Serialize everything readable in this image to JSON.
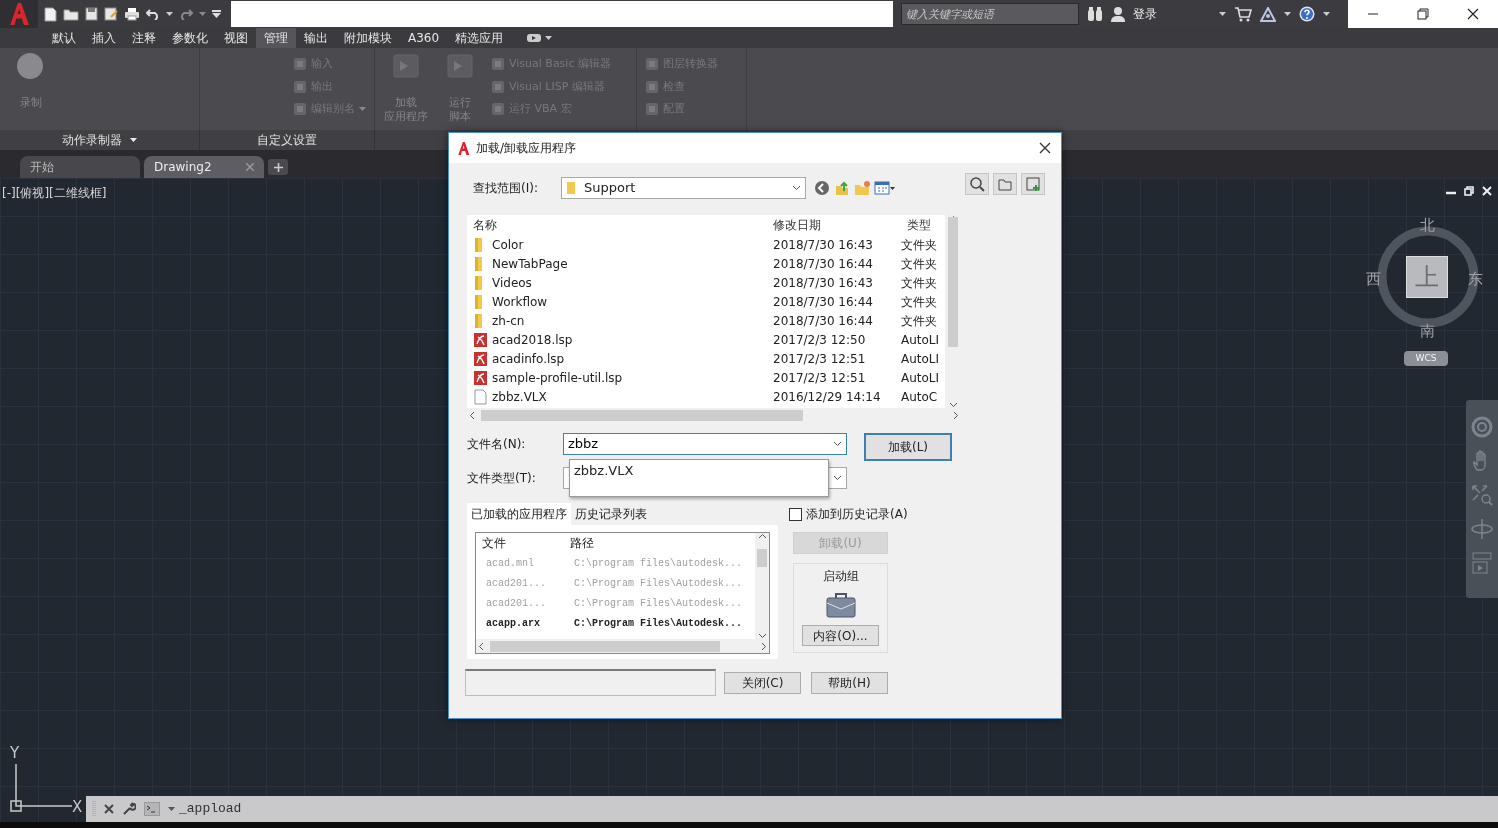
{
  "title_bar": {
    "search": {
      "placeholder": "键入关键字或短语"
    },
    "sign_in": "登录"
  },
  "ribbon_tabs": [
    {
      "label": "默认",
      "selected": false
    },
    {
      "label": "插入",
      "selected": false
    },
    {
      "label": "注释",
      "selected": false
    },
    {
      "label": "参数化",
      "selected": false
    },
    {
      "label": "视图",
      "selected": false
    },
    {
      "label": "管理",
      "selected": true
    },
    {
      "label": "输出",
      "selected": false
    },
    {
      "label": "附加模块",
      "selected": false
    },
    {
      "label": "A360",
      "selected": false
    },
    {
      "label": "精选应用",
      "selected": false
    }
  ],
  "ribbon_panels": [
    {
      "title": "动作录制器",
      "dropdown": true,
      "large": [
        {
          "lines": [
            "录制"
          ]
        }
      ]
    },
    {
      "title": "自定义设置",
      "dropdown": false,
      "small": [
        {
          "label": "输入",
          "dropdown": false
        },
        {
          "label": "输出",
          "dropdown": false
        },
        {
          "label": "编辑别名",
          "dropdown": true
        }
      ]
    },
    {
      "large": [
        {
          "lines": [
            "加载",
            "应用程序"
          ]
        },
        {
          "lines": [
            "运行",
            "脚本"
          ]
        }
      ],
      "small": [
        {
          "label": "Visual Basic 编辑器",
          "dropdown": false
        },
        {
          "label": "Visual LISP 编辑器",
          "dropdown": false
        },
        {
          "label": "运行 VBA 宏",
          "dropdown": false
        }
      ]
    },
    {
      "small": [
        {
          "label": "图层转换器",
          "dropdown": false
        },
        {
          "label": "检查",
          "dropdown": false
        },
        {
          "label": "配置",
          "dropdown": false
        }
      ]
    }
  ],
  "file_tabs": [
    {
      "label": "开始",
      "selected": false
    },
    {
      "label": "Drawing2",
      "selected": true
    }
  ],
  "viewport": {
    "label": "[-][俯视][二维线框]"
  },
  "viewcube": {
    "north": "北",
    "west": "西",
    "top": "上",
    "east": "东",
    "south": "南",
    "wcs": "WCS"
  },
  "ucs": {
    "y": "Y",
    "x": "X"
  },
  "command_line": {
    "value": "_appload"
  },
  "dialog": {
    "title": "加载/卸载应用程序",
    "look_in_label": "查找范围(I):",
    "look_in": "Support",
    "columns": [
      "名称",
      "修改日期",
      "类型"
    ],
    "files": [
      {
        "kind": "folder",
        "name": "Color",
        "date": "2018/7/30 16:43",
        "type": "文件夹"
      },
      {
        "kind": "folder",
        "name": "NewTabPage",
        "date": "2018/7/30 16:44",
        "type": "文件夹"
      },
      {
        "kind": "folder",
        "name": "Videos",
        "date": "2018/7/30 16:43",
        "type": "文件夹"
      },
      {
        "kind": "folder",
        "name": "Workflow",
        "date": "2018/7/30 16:44",
        "type": "文件夹"
      },
      {
        "kind": "folder",
        "name": "zh-cn",
        "date": "2018/7/30 16:44",
        "type": "文件夹"
      },
      {
        "kind": "lisp",
        "name": "acad2018.lsp",
        "date": "2017/2/3 12:50",
        "type": "AutoLI"
      },
      {
        "kind": "lisp",
        "name": "acadinfo.lsp",
        "date": "2017/2/3 12:51",
        "type": "AutoLI"
      },
      {
        "kind": "lisp",
        "name": "sample-profile-util.lsp",
        "date": "2017/2/3 12:51",
        "type": "AutoLI"
      },
      {
        "kind": "vlx",
        "name": "zbbz.VLX",
        "date": "2016/12/29 14:14",
        "type": "AutoC"
      }
    ],
    "filename_label": "文件名(N):",
    "filename": "zbbz",
    "suggestions": [
      "zbbz.VLX"
    ],
    "filetype_label": "文件类型(T):",
    "load_button": "加载(L)",
    "tabs": [
      {
        "label": "已加载的应用程序",
        "selected": true
      },
      {
        "label": "历史记录列表",
        "selected": false
      }
    ],
    "loaded_columns": [
      "文件",
      "路径"
    ],
    "loaded": [
      {
        "file": "acad.mnl",
        "path": "C:\\program files\\autodesk...",
        "dimmed": true
      },
      {
        "file": "acad201...",
        "path": "C:\\Program Files\\Autodesk...",
        "dimmed": true
      },
      {
        "file": "acad201...",
        "path": "C:\\Program Files\\Autodesk...",
        "dimmed": true
      },
      {
        "file": "acapp.arx",
        "path": "C:\\Program Files\\Autodesk...",
        "dimmed": false
      }
    ],
    "add_to_history": {
      "label": "添加到历史记录(A)",
      "checked": false
    },
    "unload_button": {
      "label": "卸载(U)",
      "disabled": true
    },
    "startup_group": {
      "title": "启动组",
      "button": "内容(O)..."
    },
    "close_button": "关闭(C)",
    "help_button": "帮助(H)"
  }
}
